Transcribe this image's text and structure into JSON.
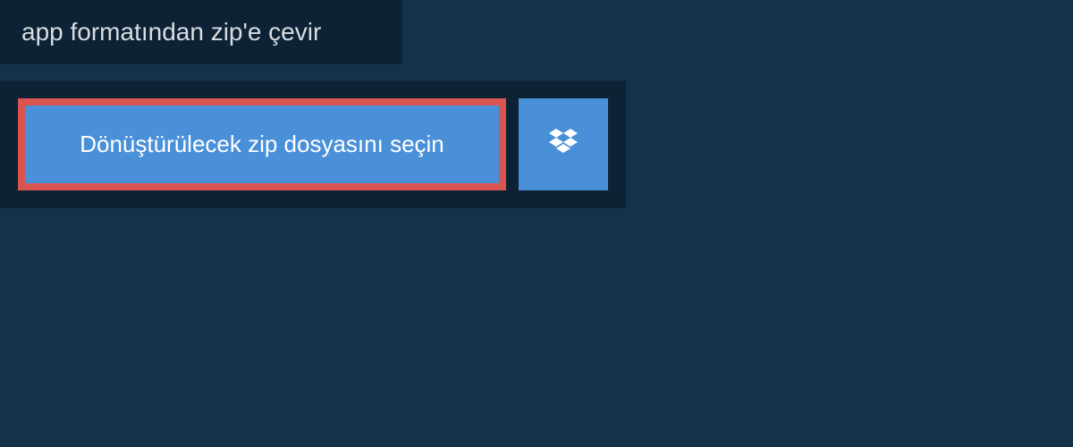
{
  "header": {
    "title": "app formatından zip'e çevir"
  },
  "actions": {
    "select_file_label": "Dönüştürülecek zip dosyasını seçin",
    "dropbox_icon": "dropbox-icon"
  },
  "colors": {
    "background": "#14334a",
    "panel": "#0d2235",
    "button": "#4a90d9",
    "highlight_border": "#d9534f",
    "text_light": "#d8dce0",
    "text_white": "#ffffff"
  }
}
